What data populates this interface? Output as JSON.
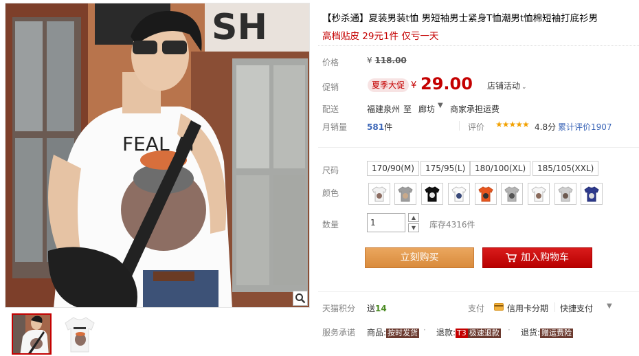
{
  "product": {
    "title": "【秒杀通】夏装男装t恤 男短袖男士紧身T恤潮男t恤棉短袖打底衫男",
    "subtitle": "高档贴皮 29元1件 仅亏一天"
  },
  "labels": {
    "price": "价格",
    "promo": "促销",
    "delivery": "配送",
    "monthly_sales": "月销量",
    "size": "尺码",
    "color": "颜色",
    "quantity": "数量",
    "tmall_points": "天猫积分",
    "service": "服务承诺"
  },
  "price": {
    "yen": "¥",
    "original": "118.00",
    "promo_badge": "夏季大促",
    "promo": "29.00",
    "shop_activity": "店铺活动"
  },
  "delivery": {
    "from": "福建泉州",
    "arrow": "至",
    "to": "廊坊",
    "fee": "商家承担运费"
  },
  "sales": {
    "count": "581",
    "unit": "件",
    "rating_label": "评价",
    "stars": "★★★★★",
    "rating": "4.8分",
    "review_count": "累计评价1907"
  },
  "sizes": [
    "170/90(M)",
    "175/95(L)",
    "180/100(XL)",
    "185/105(XXL)"
  ],
  "colors": [
    "white-grey-print",
    "grey-print",
    "black-print",
    "white-print",
    "orange-print",
    "grey-print-2",
    "white-print-2",
    "grey-print-3",
    "navy-print"
  ],
  "quantity": {
    "value": "1",
    "stock": "库存4316件"
  },
  "buttons": {
    "buy_now": "立刻购买",
    "add_to_cart": "加入购物车"
  },
  "points": {
    "prefix": "送",
    "value": "14"
  },
  "payment": {
    "label": "支付",
    "credit_installment": "信用卡分期",
    "quick_pay": "快捷支付"
  },
  "service": {
    "goods_prefix": "商品:",
    "goods_tag": "按时发货",
    "refund_prefix": "退款:",
    "refund_badge": "T3",
    "refund_tag": "极速退款",
    "return_prefix": "退货:",
    "return_tag": "赠运费险"
  },
  "icons": {
    "zoom": "magnifier-icon",
    "cart": "cart-icon",
    "credit_card": "credit-card-icon"
  },
  "colors_theme": {
    "accent_red": "#c40000",
    "buy_orange": "#e49a4e",
    "link_blue": "#3d67b8"
  }
}
